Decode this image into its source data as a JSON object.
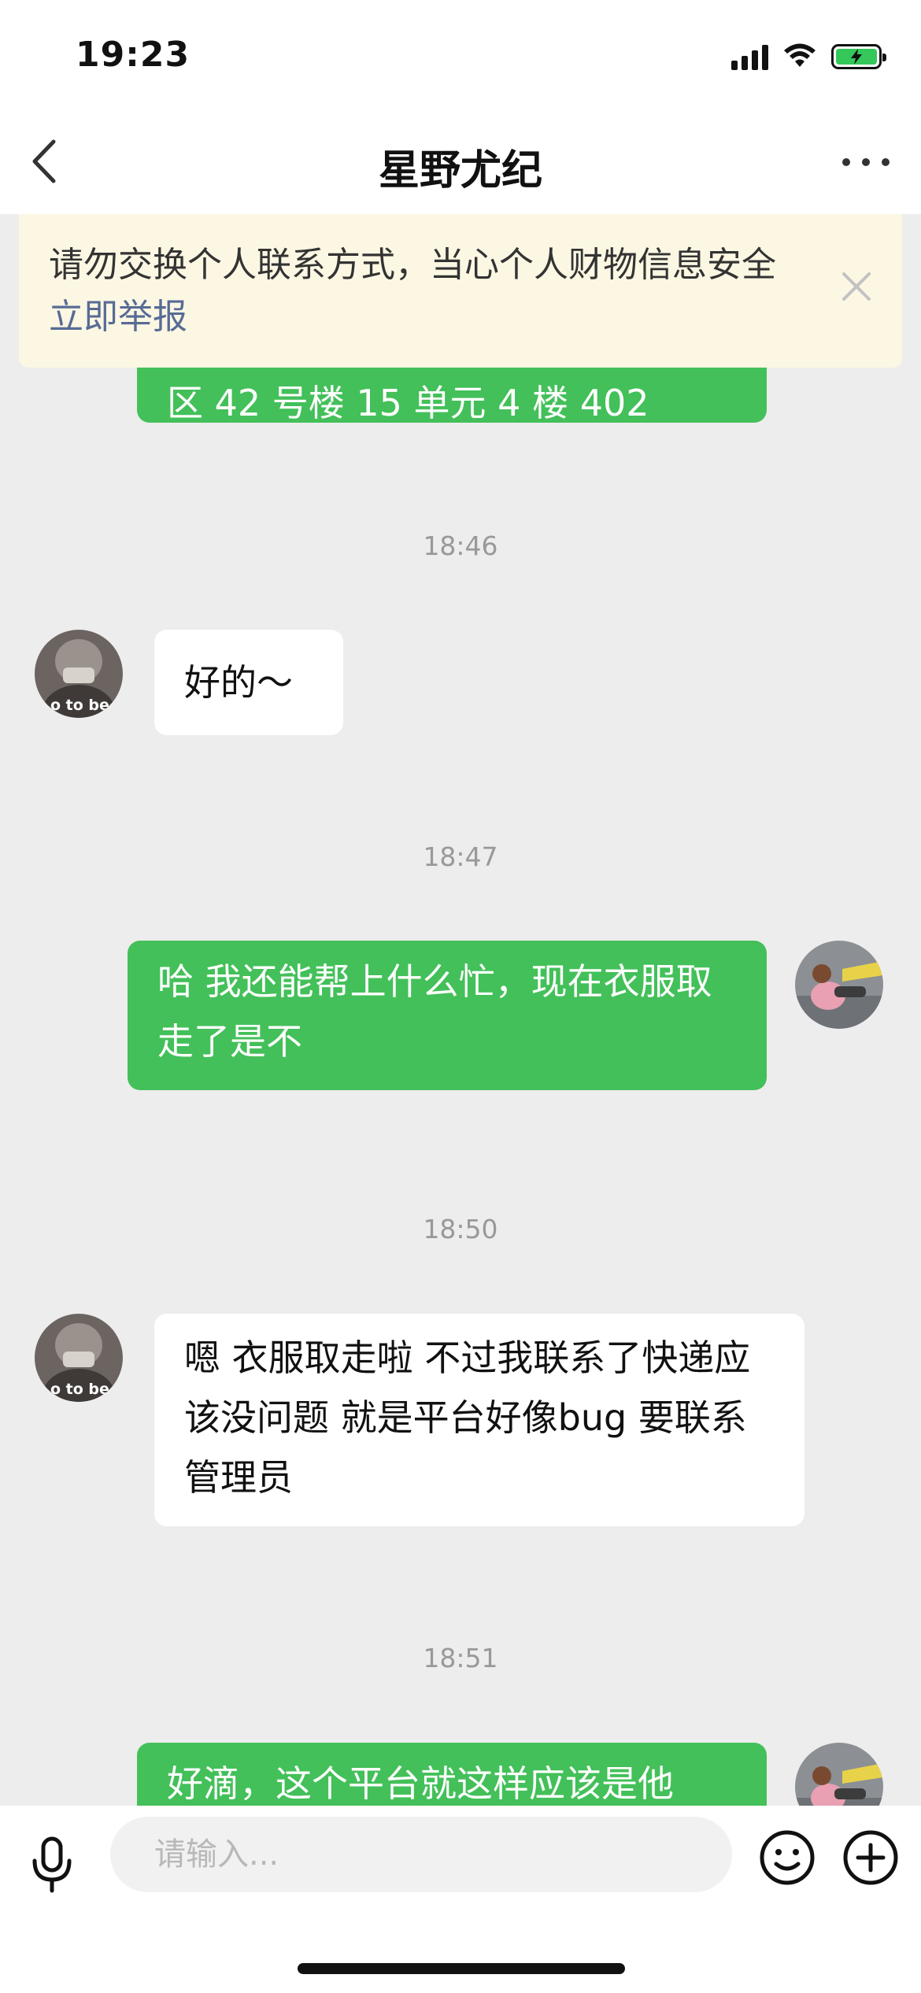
{
  "status_bar": {
    "time": "19:23"
  },
  "header": {
    "title": "星野尤纪"
  },
  "banner": {
    "text": "请勿交换个人联系方式，当心个人财物信息安全",
    "link": "立即举报"
  },
  "messages": [
    {
      "type": "sent",
      "text": "区 42 号楼 15 单元 4 楼 402"
    },
    {
      "type": "timestamp",
      "text": "18:46"
    },
    {
      "type": "received",
      "text": "好的～"
    },
    {
      "type": "timestamp",
      "text": "18:47"
    },
    {
      "type": "sent",
      "text": "哈 我还能帮上什么忙，现在衣服取走了是不"
    },
    {
      "type": "timestamp",
      "text": "18:50"
    },
    {
      "type": "received",
      "text": "嗯 衣服取走啦 不过我联系了快递应该没问题 就是平台好像bug 要联系管理员"
    },
    {
      "type": "timestamp",
      "text": "18:51"
    },
    {
      "type": "sent",
      "text": "好滴，这个平台就这样应该是他"
    }
  ],
  "input": {
    "placeholder": "请输入..."
  },
  "colors": {
    "sent_bubble": "#43c059",
    "received_bubble": "#ffffff",
    "banner_bg": "#fcf7e3",
    "link": "#576b95"
  }
}
